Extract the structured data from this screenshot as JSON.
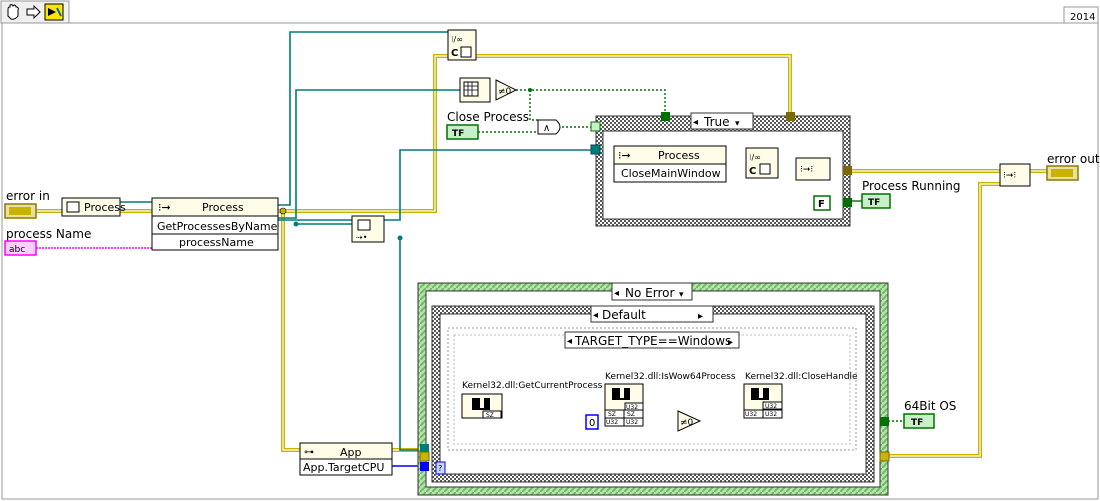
{
  "toolbar": {
    "icons": [
      "hand-icon",
      "arrow-right-icon",
      "labview-run-icon"
    ],
    "version": "2014"
  },
  "terminals": {
    "error_in": "error in",
    "process_name": "process Name",
    "close_process": "Close Process",
    "error_out": "error out",
    "process_running": "Process Running",
    "bit64_os": "64Bit OS",
    "tf_label": "TF",
    "abc_label": "abc",
    "false_const": "F",
    "zero_const": "0"
  },
  "nodes": {
    "process_node": "Process",
    "process_class": "Process",
    "get_processes_by_name": "GetProcessesByName",
    "process_name_param": "processName",
    "process_invoke2": "Process",
    "close_main_window": "CloseMainWindow",
    "app_node": "App",
    "app_target_cpu": "App.TargetCPU",
    "not_equal_zero": "≠0",
    "and_op": "∧",
    "get_current_process": "Kernel32.dll:GetCurrentProcess",
    "is_wow64_process": "Kernel32.dll:IsWow64Process",
    "close_handle": "Kernel32.dll:CloseHandle",
    "sz": "SZ",
    "u32": "U32",
    "unbundle_code": "C"
  },
  "structures": {
    "case_true": "True",
    "case_no_error": "No Error",
    "case_default": "Default",
    "conditional": "TARGET_TYPE==Windows"
  },
  "colors": {
    "error_wire": "#c8b400",
    "refnum_wire": "#007c7c",
    "bool_wire": "#007000",
    "string_wire": "#ff00ff",
    "int_wire": "#0000ff",
    "node_header": "#fffce8",
    "bool_terminal": "#007000"
  }
}
